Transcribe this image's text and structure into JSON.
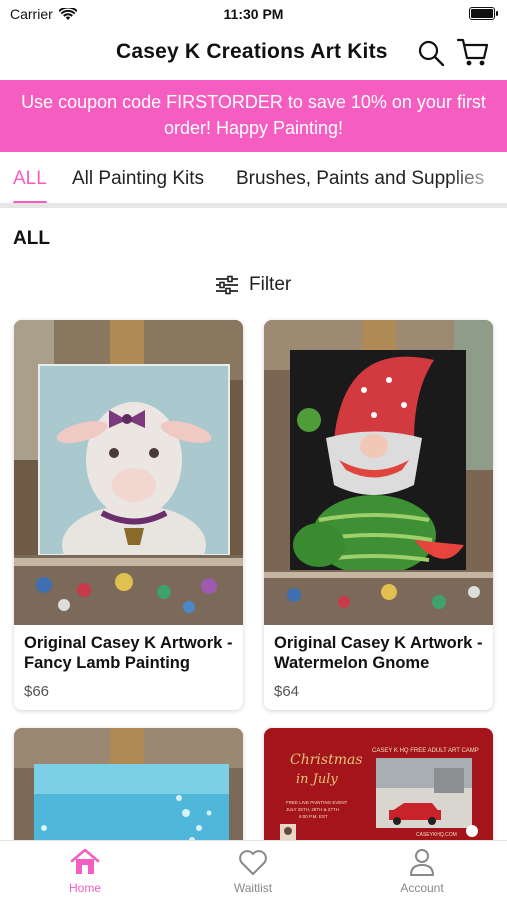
{
  "status": {
    "carrier": "Carrier",
    "time": "11:30 PM"
  },
  "header": {
    "title": "Casey K Creations Art Kits"
  },
  "banner": {
    "text": "Use coupon code FIRSTORDER to save 10% on your first order!  Happy Painting!"
  },
  "tabs": [
    {
      "label": "ALL",
      "active": true
    },
    {
      "label": "All Painting Kits",
      "active": false
    },
    {
      "label": "Brushes, Paints and Supplies",
      "active": false
    }
  ],
  "section": {
    "title": "ALL"
  },
  "filter": {
    "label": "Filter"
  },
  "products": [
    {
      "title": "Original Casey K Artwork - Fancy Lamb Painting",
      "price": "$66"
    },
    {
      "title": "Original Casey K Artwork - Watermelon Gnome",
      "price": "$64"
    }
  ],
  "promo_card": {
    "script_title": "Christmas in July",
    "heading": "CASEY K HQ FREE ADULT ART CAMP",
    "subtitle": "FREE LIVE PAINTING EVENT",
    "dates": "JULY 25TH, 26TH & 27TH",
    "time": "6:00 P.M. EST",
    "url": "CASEYKHQ.COM"
  },
  "bottom_nav": {
    "home": "Home",
    "waitlist": "Waitlist",
    "account": "Account"
  },
  "colors": {
    "accent": "#f55ec0",
    "promo_red": "#a3151a"
  }
}
